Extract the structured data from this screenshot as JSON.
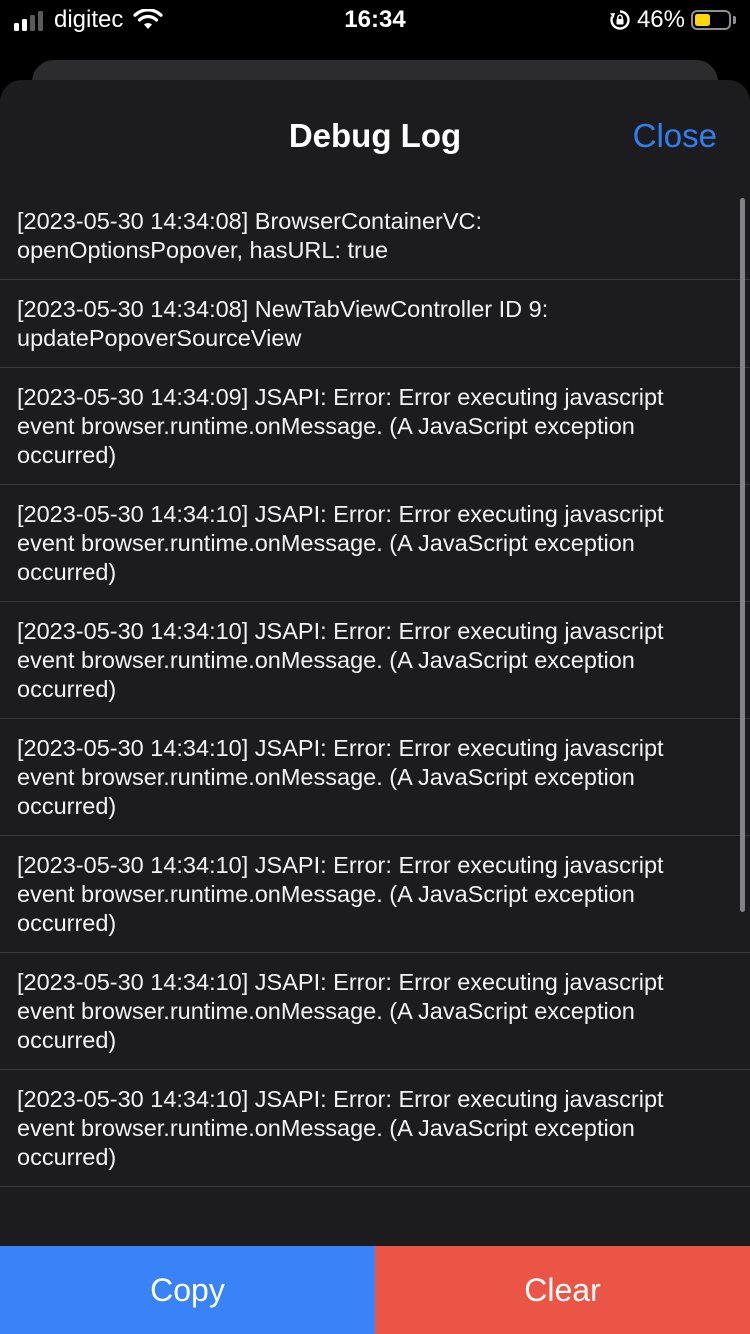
{
  "status_bar": {
    "carrier": "digitec",
    "time": "16:34",
    "battery_percent": "46%",
    "battery_level": 0.46,
    "signal_icon": "cellular-signal-icon",
    "wifi_icon": "wifi-icon",
    "rotation_lock_icon": "rotation-lock-icon",
    "battery_icon": "battery-icon",
    "battery_color": "#ffd60a"
  },
  "nav": {
    "title": "Debug Log",
    "close_label": "Close",
    "accent_color": "#2f7ff0"
  },
  "log": {
    "entries": [
      "[2023-05-30 14:34:08] BrowserContainerVC:\nopenOptionsPopover, hasURL: true",
      "[2023-05-30 14:34:08] NewTabViewController ID 9:\nupdatePopoverSourceView",
      "[2023-05-30 14:34:09] JSAPI: Error: Error executing javascript\nevent browser.runtime.onMessage. (A JavaScript exception\noccurred)",
      "[2023-05-30 14:34:10] JSAPI: Error: Error executing javascript\nevent browser.runtime.onMessage. (A JavaScript exception\noccurred)",
      "[2023-05-30 14:34:10] JSAPI: Error: Error executing javascript\nevent browser.runtime.onMessage. (A JavaScript exception\noccurred)",
      "[2023-05-30 14:34:10] JSAPI: Error: Error executing javascript\nevent browser.runtime.onMessage. (A JavaScript exception\noccurred)",
      "[2023-05-30 14:34:10] JSAPI: Error: Error executing javascript\nevent browser.runtime.onMessage. (A JavaScript exception\noccurred)",
      "[2023-05-30 14:34:10] JSAPI: Error: Error executing javascript\nevent browser.runtime.onMessage. (A JavaScript exception\noccurred)",
      "[2023-05-30 14:34:10] JSAPI: Error: Error executing javascript\nevent browser.runtime.onMessage. (A JavaScript exception\noccurred)"
    ]
  },
  "toolbar": {
    "copy_label": "Copy",
    "clear_label": "Clear",
    "copy_color": "#3a82f7",
    "clear_color": "#eb5545"
  },
  "colors": {
    "sheet_background": "#1c1c1e",
    "separator": "#38383a"
  }
}
